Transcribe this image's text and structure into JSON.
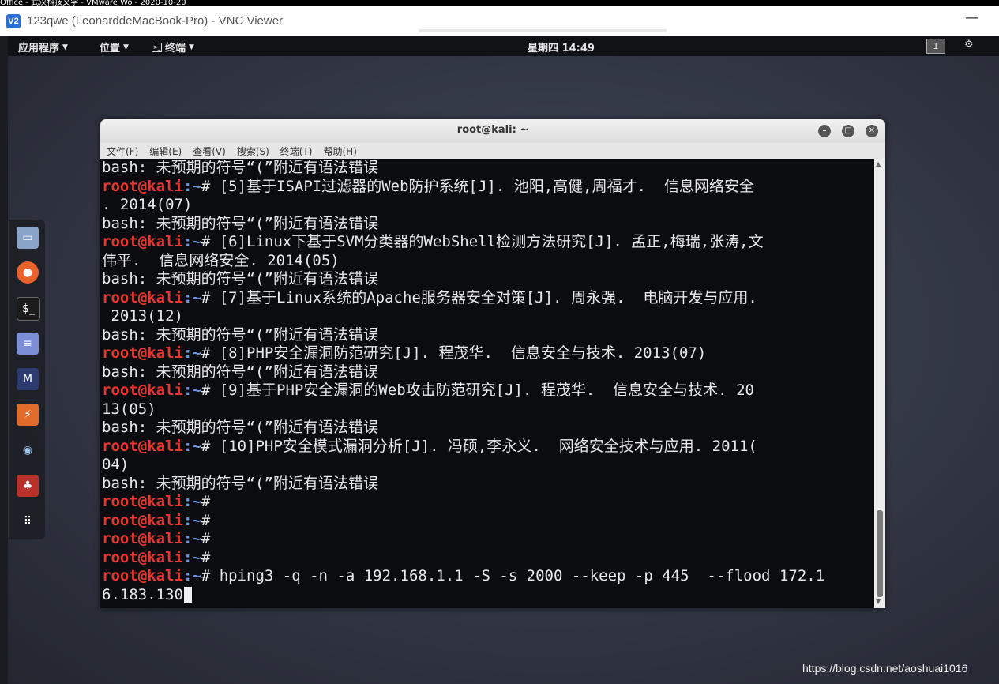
{
  "host": {
    "strip_text": "Office - 武汉科技文学 - VMware Wo - 2020-10-20"
  },
  "vnc": {
    "title": "123qwe (LeonarddeMacBook-Pro) - VNC Viewer",
    "logo": "V2",
    "minimize_label": "—"
  },
  "top_panel": {
    "applications": "应用程序",
    "places": "位置",
    "terminal": "终端",
    "clock": "星期四 14:49",
    "workspace": "1"
  },
  "terminal": {
    "title": "root@kali: ~",
    "menu": [
      "文件(F)",
      "编辑(E)",
      "查看(V)",
      "搜索(S)",
      "终端(T)",
      "帮助(H)"
    ],
    "lines": [
      {
        "type": "out",
        "text": "bash: 未预期的符号“(”附近有语法错误"
      },
      {
        "type": "cmd",
        "user": "root@kali",
        "path": ":~",
        "text": "# [5]基于ISAPI过滤器的Web防护系统[J]. 池阳,高健,周福才.  信息网络安全"
      },
      {
        "type": "out",
        "text": ". 2014(07)"
      },
      {
        "type": "out",
        "text": "bash: 未预期的符号“(”附近有语法错误"
      },
      {
        "type": "cmd",
        "user": "root@kali",
        "path": ":~",
        "text": "# [6]Linux下基于SVM分类器的WebShell检测方法研究[J]. 孟正,梅瑞,张涛,文"
      },
      {
        "type": "out",
        "text": "伟平.  信息网络安全. 2014(05)"
      },
      {
        "type": "out",
        "text": "bash: 未预期的符号“(”附近有语法错误"
      },
      {
        "type": "cmd",
        "user": "root@kali",
        "path": ":~",
        "text": "# [7]基于Linux系统的Apache服务器安全对策[J]. 周永强.  电脑开发与应用."
      },
      {
        "type": "out",
        "text": " 2013(12)"
      },
      {
        "type": "out",
        "text": "bash: 未预期的符号“(”附近有语法错误"
      },
      {
        "type": "cmd",
        "user": "root@kali",
        "path": ":~",
        "text": "# [8]PHP安全漏洞防范研究[J]. 程茂华.  信息安全与技术. 2013(07)"
      },
      {
        "type": "out",
        "text": "bash: 未预期的符号“(”附近有语法错误"
      },
      {
        "type": "cmd",
        "user": "root@kali",
        "path": ":~",
        "text": "# [9]基于PHP安全漏洞的Web攻击防范研究[J]. 程茂华.  信息安全与技术. 20"
      },
      {
        "type": "out",
        "text": "13(05)"
      },
      {
        "type": "out",
        "text": "bash: 未预期的符号“(”附近有语法错误"
      },
      {
        "type": "cmd",
        "user": "root@kali",
        "path": ":~",
        "text": "# [10]PHP安全模式漏洞分析[J]. 冯硕,李永义.  网络安全技术与应用. 2011("
      },
      {
        "type": "out",
        "text": "04)"
      },
      {
        "type": "out",
        "text": "bash: 未预期的符号“(”附近有语法错误"
      },
      {
        "type": "cmd",
        "user": "root@kali",
        "path": ":~",
        "text": "#"
      },
      {
        "type": "cmd",
        "user": "root@kali",
        "path": ":~",
        "text": "#"
      },
      {
        "type": "cmd",
        "user": "root@kali",
        "path": ":~",
        "text": "#"
      },
      {
        "type": "cmd",
        "user": "root@kali",
        "path": ":~",
        "text": "#"
      },
      {
        "type": "cmd",
        "user": "root@kali",
        "path": ":~",
        "text": "# hping3 -q -n -a 192.168.1.1 -S -s 2000 --keep -p 445  --flood 172.1"
      },
      {
        "type": "out",
        "text": "6.183.130",
        "cursor": true
      }
    ]
  },
  "dock": {
    "icons": [
      "files-icon",
      "firefox-icon",
      "terminal-icon",
      "text-editor-icon",
      "metasploit-icon",
      "burpsuite-icon",
      "eye-icon",
      "cherrytree-icon",
      "app-grid-icon"
    ]
  },
  "watermark": "https://blog.csdn.net/aoshuai1016"
}
